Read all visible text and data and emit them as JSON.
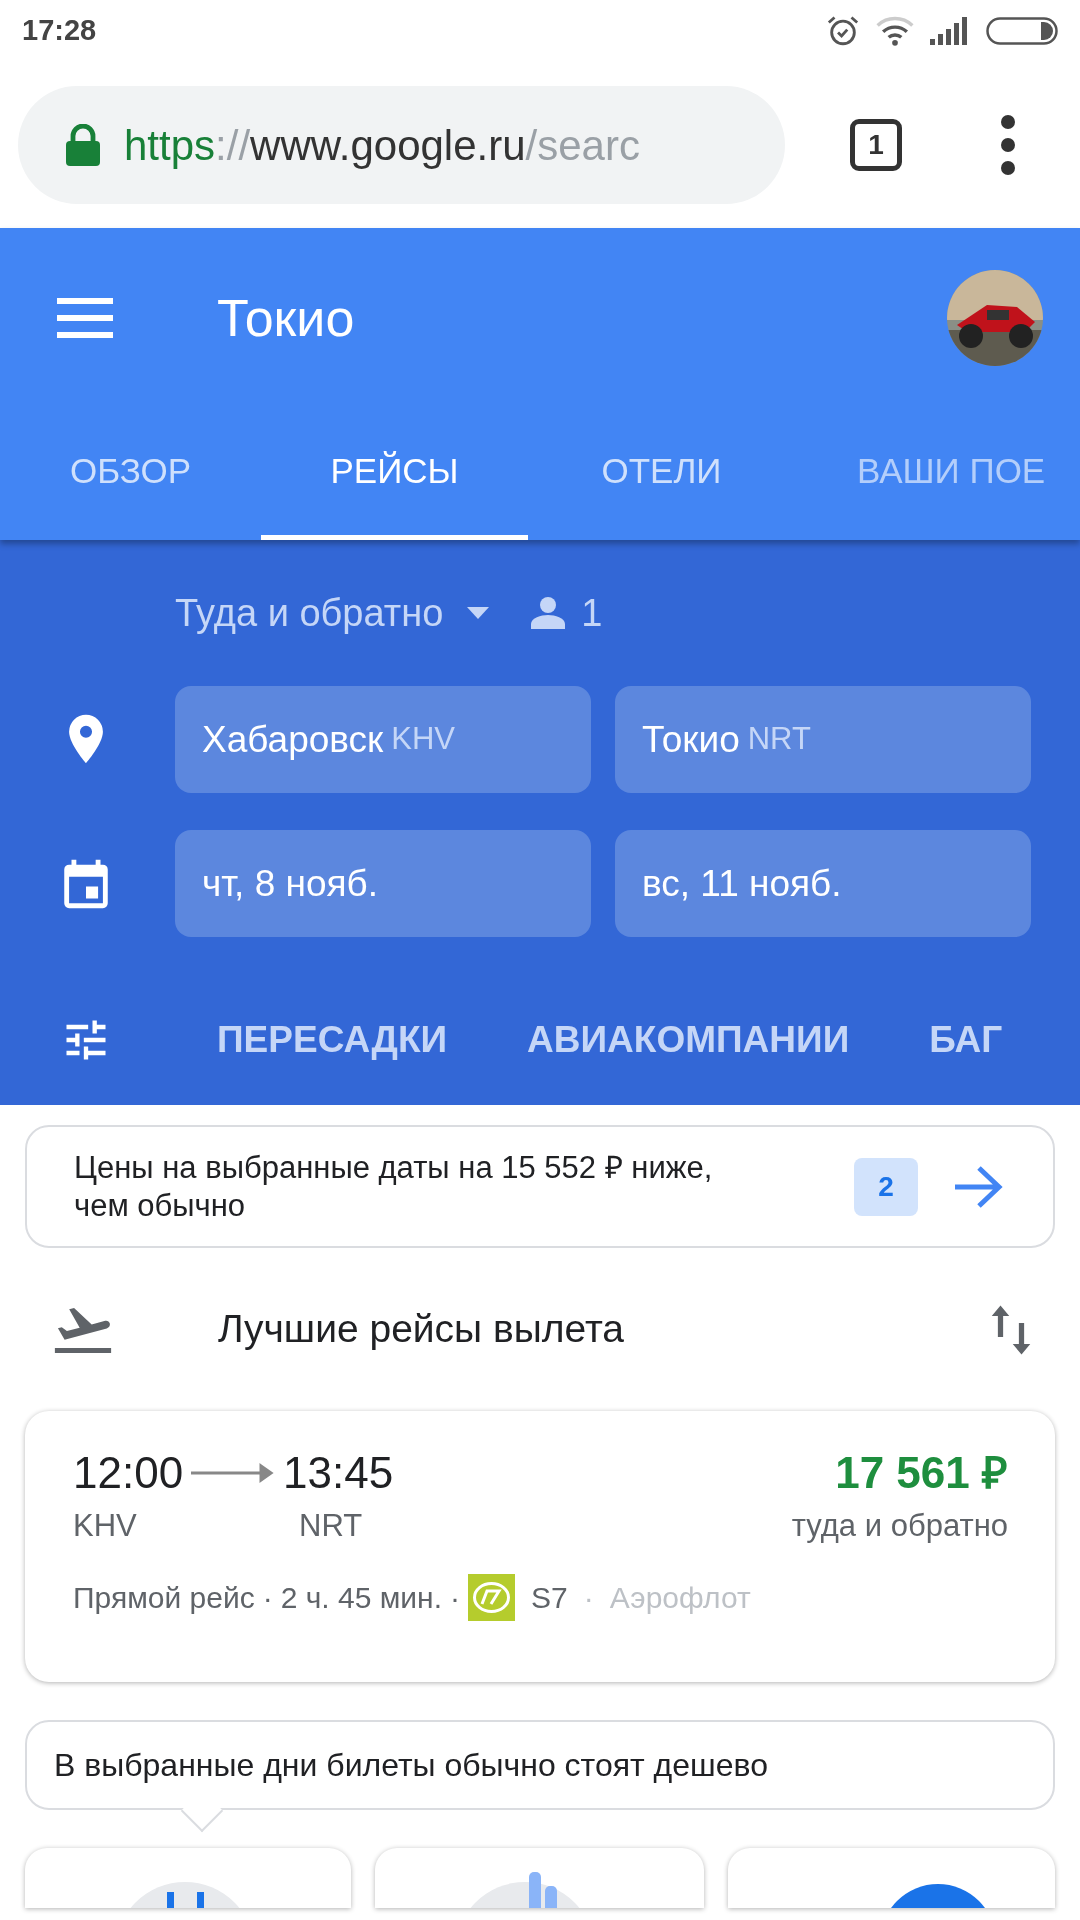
{
  "status_bar": {
    "time": "17:28"
  },
  "browser": {
    "url_scheme": "https",
    "url_separator": "://",
    "url_host": "www.google.ru",
    "url_path": "/searc",
    "tab_count": "1"
  },
  "header": {
    "title": "Токио",
    "tabs": [
      {
        "label": "ОБЗОР",
        "selected": false
      },
      {
        "label": "РЕЙСЫ",
        "selected": true
      },
      {
        "label": "ОТЕЛИ",
        "selected": false
      },
      {
        "label": "ВАШИ ПОЕ",
        "selected": false
      }
    ]
  },
  "search": {
    "trip_type": "Туда и обратно",
    "passengers": "1",
    "origin": {
      "city": "Хабаровск",
      "code": "KHV"
    },
    "destination": {
      "city": "Токио",
      "code": "NRT"
    },
    "depart_date": "чт, 8 нояб.",
    "return_date": "вс, 11 нояб."
  },
  "filters": [
    "ПЕРЕСАДКИ",
    "АВИАКОМПАНИИ",
    "БАГ"
  ],
  "banner": {
    "text": "Цены на выбранные даты на 15 552 ₽ ниже, чем обычно",
    "badge": "2"
  },
  "section": {
    "title": "Лучшие рейсы вылета"
  },
  "flight": {
    "depart_time": "12:00",
    "arrive_time": "13:45",
    "origin_code": "KHV",
    "dest_code": "NRT",
    "price": "17 561 ₽",
    "price_note": "туда и обратно",
    "stops": "Прямой рейс",
    "duration": "2 ч. 45 мин.",
    "airline": "S7",
    "partner": "Аэрофлот",
    "separators": [
      "·",
      "·",
      "·"
    ]
  },
  "tip": {
    "text": "В выбранные дни билеты обычно стоят дешево"
  }
}
